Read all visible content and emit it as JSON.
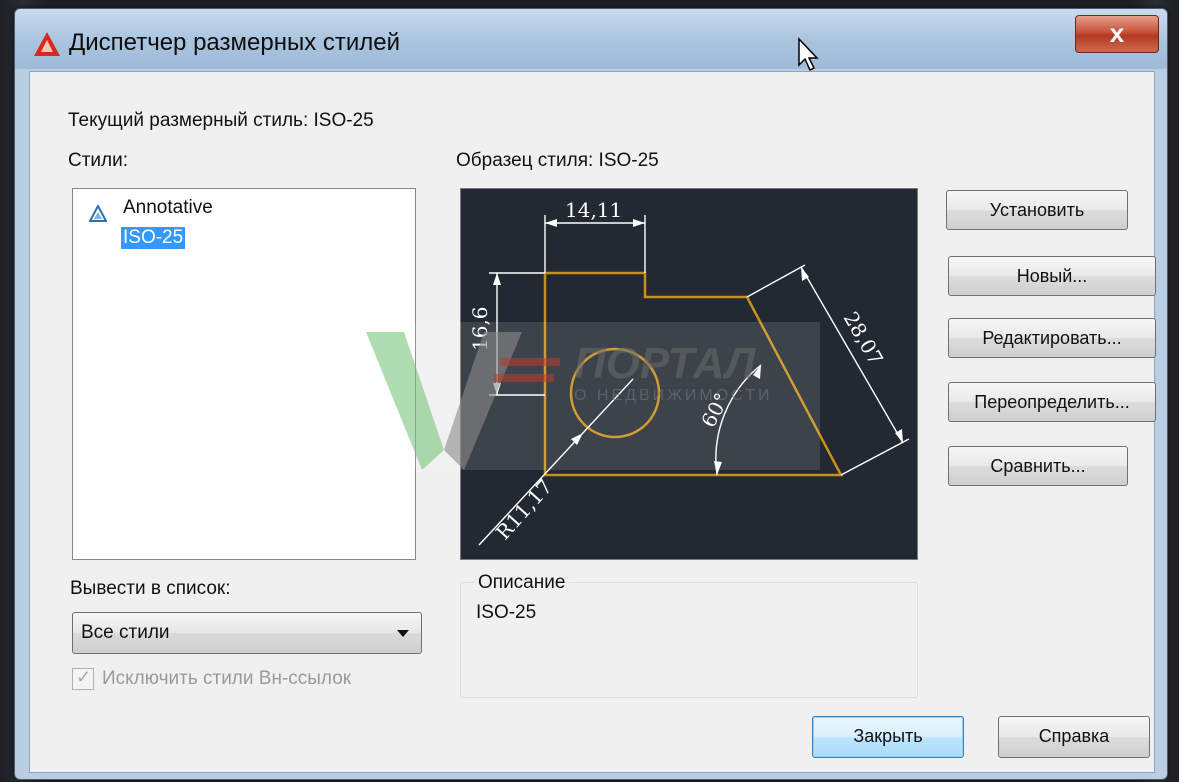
{
  "window": {
    "title": "Диспетчер размерных стилей",
    "close_glyph": "x"
  },
  "current_style": {
    "label": "Текущий размерный стиль: ISO-25"
  },
  "styles": {
    "label": "Стили:",
    "items": [
      {
        "label": "Annotative",
        "icon": "annotative-icon",
        "selected": false
      },
      {
        "label": "ISO-25",
        "selected": true
      }
    ]
  },
  "preview": {
    "label": "Образец стиля: ISO-25",
    "dims": {
      "width": "14,11",
      "height": "16,6",
      "diagonal": "28,07",
      "angle": "60°",
      "radius": "R11,17"
    }
  },
  "buttons": {
    "set_current": "Установить",
    "new": "Новый...",
    "modify": "Редактировать...",
    "override": "Переопределить...",
    "compare": "Сравнить...",
    "close": "Закрыть",
    "help": "Справка"
  },
  "list_filter": {
    "label": "Вывести в список:",
    "value": "Все стили"
  },
  "exclude_xref": {
    "label": "Исключить стили Вн-ссылок",
    "checked": true,
    "enabled": false
  },
  "description": {
    "title": "Описание",
    "text": "ISO-25"
  },
  "watermark": {
    "line1": "ПОРТАЛ",
    "line2": "О НЕДВИЖИМОСТИ"
  },
  "colors": {
    "preview_bg": "#222933",
    "geometry": "#c8901a",
    "dimension": "#ffffff",
    "selection": "#3399ff"
  }
}
